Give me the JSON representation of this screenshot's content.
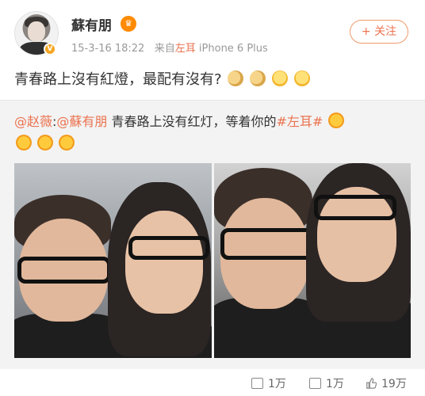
{
  "user": {
    "name": "蘇有朋",
    "vip_glyph": "♛",
    "verified_glyph": "V",
    "time": "15-3-16 18:22",
    "source_prefix": "来自",
    "source": "左耳",
    "device": "iPhone 6 Plus"
  },
  "follow_button": {
    "label": "+ 关注"
  },
  "post": {
    "text": "青春路上沒有紅燈，最配有沒有?"
  },
  "repost": {
    "mention1": "@赵薇",
    "sep": ":",
    "mention2": "@蘇有朋",
    "text": " 青春路上没有红灯，等着你的",
    "hashtag": "#左耳#"
  },
  "actions": {
    "repost_count": "1万",
    "comment_count": "1万",
    "like_count": "19万"
  },
  "colors": {
    "accent": "#eb7350",
    "repost_bg": "#f3f3f3",
    "meta_gray": "#999999"
  }
}
